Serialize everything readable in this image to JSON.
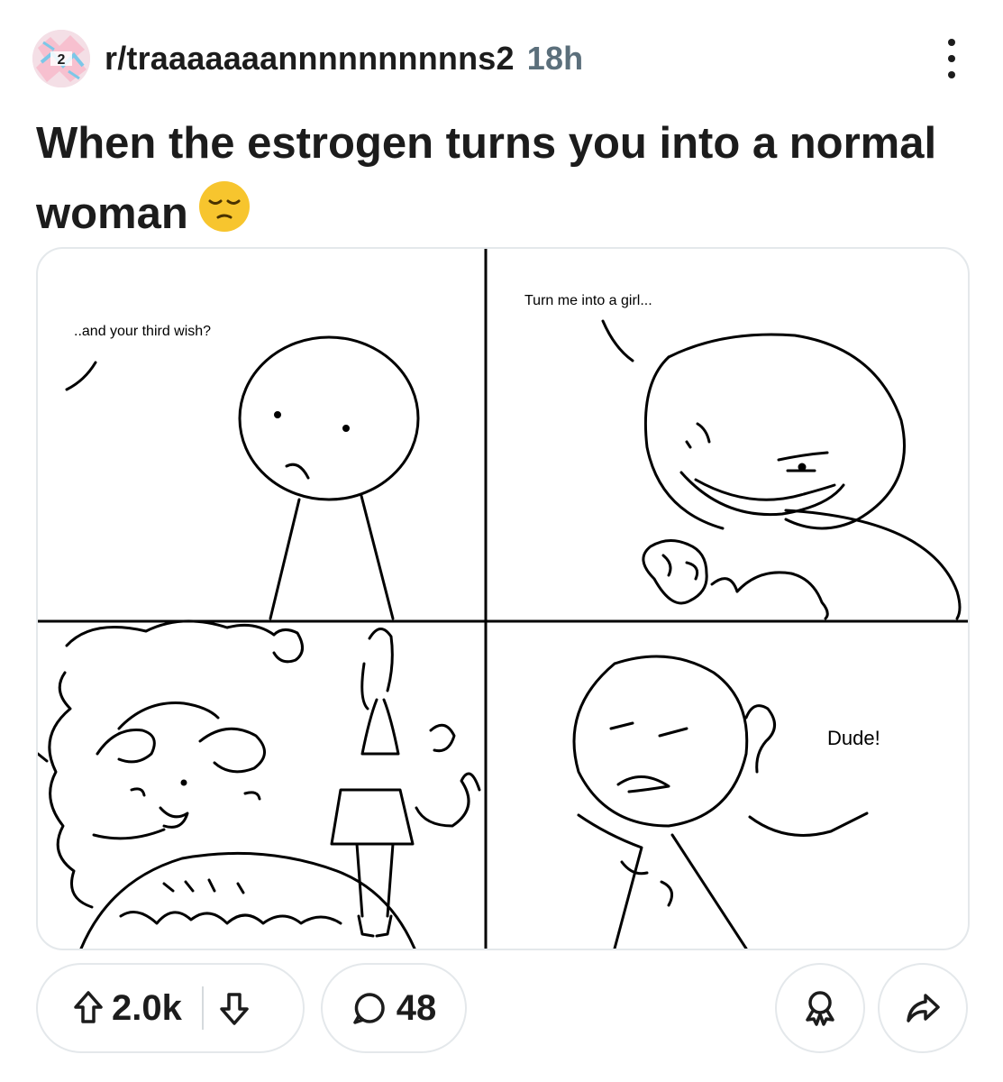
{
  "post": {
    "subreddit": "r/traaaaaaannnnnnnnnns2",
    "age": "18h",
    "title": "When the estrogen turns you into a normal woman",
    "title_emoji": "pensive-face-emoji",
    "avatar_label": "2"
  },
  "comic": {
    "panel1_text": "..and your third wish?",
    "panel2_text": "Turn me into a girl...",
    "panel4_text": "Dude!"
  },
  "actions": {
    "upvotes": "2.0k",
    "comments": "48",
    "icons": [
      "arrow-up-icon",
      "arrow-down-icon",
      "comment-icon",
      "award-icon",
      "share-icon",
      "more-vertical-icon"
    ]
  },
  "colors": {
    "text": "#1c1c1c",
    "muted": "#5b6f7b",
    "border": "#e4e8eb",
    "emoji": "#f7c52e"
  }
}
